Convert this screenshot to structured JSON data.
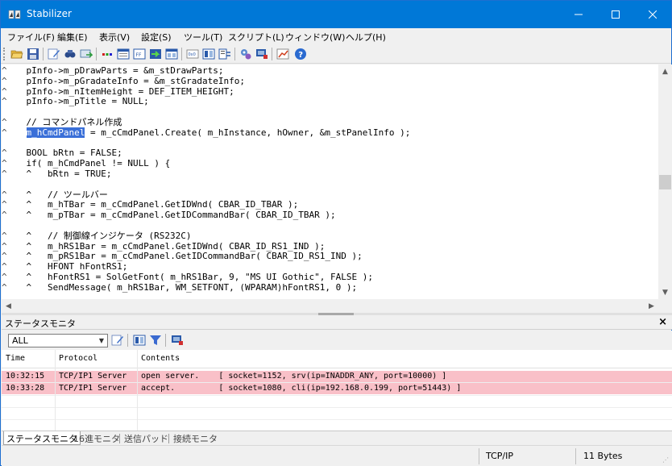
{
  "window": {
    "title": "Stabilizer",
    "min_icon": "minimize-icon",
    "max_icon": "maximize-icon",
    "close_icon": "close-icon"
  },
  "menu": [
    "ファイル(F)",
    "編集(E)",
    "表示(V)",
    "設定(S)",
    "ツール(T)",
    "スクリプト(L)",
    "ウィンドウ(W)",
    "ヘルプ(H)"
  ],
  "toolbar_icons": [
    "open-folder-icon",
    "save-icon",
    "edit-icon",
    "find-icon",
    "connect-icon",
    "dots-icon",
    "window-icon",
    "ff-icon",
    "send-icon",
    "window-split-icon",
    "hex-icon",
    "list-icon",
    "transfer-icon",
    "settings-icon",
    "monitor-icon",
    "chart-icon",
    "help-icon"
  ],
  "editor": {
    "lines": [
      {
        "g": "^",
        "code": "    pInfo->m_pDrawParts = &m_stDrawParts;"
      },
      {
        "g": "^",
        "code": "    pInfo->m_pGradateInfo = &m_stGradateInfo;"
      },
      {
        "g": "^",
        "code": "    pInfo->m_nItemHeight = DEF_ITEM_HEIGHT;"
      },
      {
        "g": "^",
        "code": "    pInfo->m_pTitle = NULL;"
      },
      {
        "g": "",
        "code": ""
      },
      {
        "g": "^",
        "code": "    // コマンドパネル作成"
      },
      {
        "g": "^",
        "sel": "m_hCmdPanel",
        "code": " = m_cCmdPanel.Create( m_hInstance, hOwner, &m_stPanelInfo );"
      },
      {
        "g": "",
        "code": ""
      },
      {
        "g": "^",
        "code": "    BOOL bRtn = FALSE;"
      },
      {
        "g": "^",
        "code": "    if( m_hCmdPanel != NULL ) {"
      },
      {
        "g": "^",
        "code": "    ^   bRtn = TRUE;"
      },
      {
        "g": "",
        "code": ""
      },
      {
        "g": "^",
        "code": "    ^   // ツールバー"
      },
      {
        "g": "^",
        "code": "    ^   m_hTBar = m_cCmdPanel.GetIDWnd( CBAR_ID_TBAR );"
      },
      {
        "g": "^",
        "code": "    ^   m_pTBar = m_cCmdPanel.GetIDCommandBar( CBAR_ID_TBAR );"
      },
      {
        "g": "",
        "code": ""
      },
      {
        "g": "^",
        "code": "    ^   // 制御線インジケータ (RS232C)"
      },
      {
        "g": "^",
        "code": "    ^   m_hRS1Bar = m_cCmdPanel.GetIDWnd( CBAR_ID_RS1_IND );"
      },
      {
        "g": "^",
        "code": "    ^   m_pRS1Bar = m_cCmdPanel.GetIDCommandBar( CBAR_ID_RS1_IND );"
      },
      {
        "g": "^",
        "code": "    ^   HFONT hFontRS1;"
      },
      {
        "g": "^",
        "code": "    ^   hFontRS1 = SolGetFont( m_hRS1Bar, 9, \"MS UI Gothic\", FALSE );"
      },
      {
        "g": "^",
        "code": "    ^   SendMessage( m_hRS1Bar, WM_SETFONT, (WPARAM)hFontRS1, 0 );"
      }
    ]
  },
  "status_monitor": {
    "title": "ステータスモニタ",
    "filter_value": "ALL",
    "columns": [
      "Time",
      "Protocol",
      "Contents"
    ],
    "rows": [
      {
        "time": "10:32:15",
        "protocol": "TCP/IP1 Server",
        "contents": "open server.    [ socket=1152, srv(ip=INADDR_ANY, port=10000) ]"
      },
      {
        "time": "10:33:28",
        "protocol": "TCP/IP1 Server",
        "contents": "accept.         [ socket=1080, cli(ip=192.168.0.199, port=51443) ]"
      }
    ],
    "tabs": [
      "ステータスモニタ",
      "16進モニタ",
      "送信パッド",
      "接続モニタ"
    ]
  },
  "statusbar": {
    "protocol": "TCP/IP",
    "bytes": "11 Bytes"
  },
  "colors": {
    "titlebar": "#0078d7",
    "log_row": "#f9c0c8",
    "selection": "#3a6fd8"
  }
}
